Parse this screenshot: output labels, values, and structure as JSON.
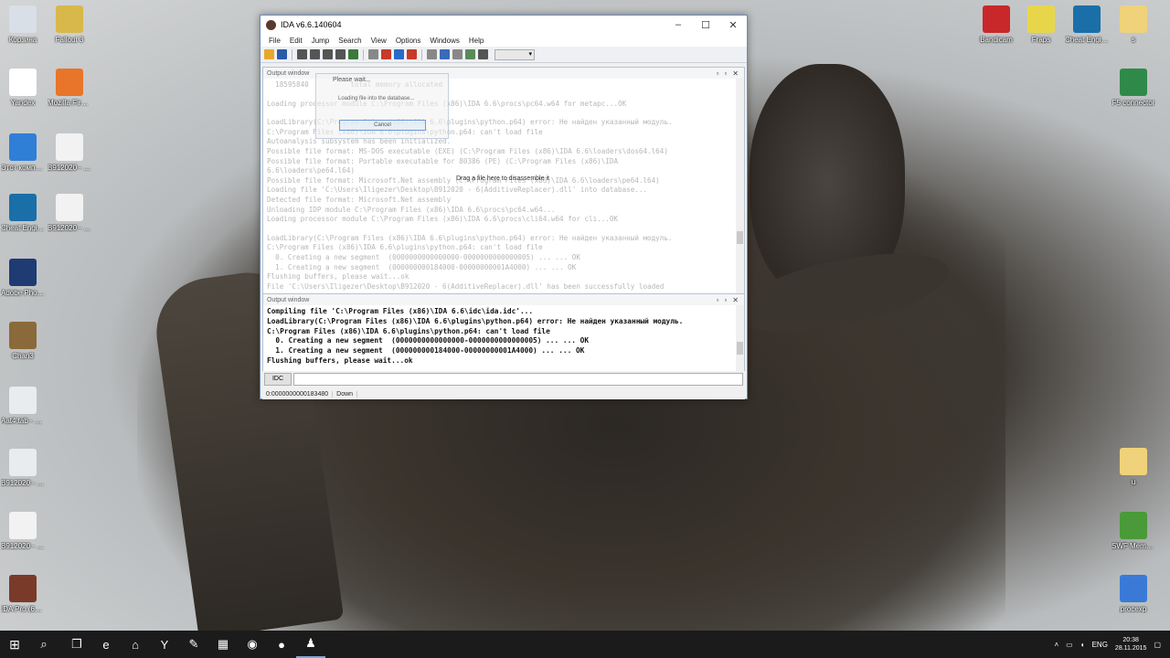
{
  "desktop_icons_left": [
    {
      "label": "Корзина",
      "icon": "recycle-bin-icon",
      "color": "#d9dfe6"
    },
    {
      "label": "Yandex",
      "icon": "yandex-icon",
      "color": "#ffffff"
    },
    {
      "label": "Этот компьютер",
      "icon": "computer-icon",
      "color": "#2f7fd6"
    },
    {
      "label": "Cheat Engine",
      "icon": "cheat-engine-icon",
      "color": "#1a6fa8"
    },
    {
      "label": "Adobe Photoshop",
      "icon": "photoshop-icon",
      "color": "#1f3b74"
    },
    {
      "label": "Chan3",
      "icon": "image-file-icon",
      "color": "#8a6a3a"
    },
    {
      "label": "Aat4.tab - 6(AdditiveRe...",
      "icon": "dll-file-icon",
      "color": "#e9ecef"
    },
    {
      "label": "B912020 - 6(AdditiveRe...",
      "icon": "dll-file-icon",
      "color": "#e9ecef"
    },
    {
      "label": "B912020 - 6(AdditiveRe...",
      "icon": "file-icon",
      "color": "#f2f2f2"
    },
    {
      "label": "IDA Pro (64-bit)",
      "icon": "ida-pro-icon",
      "color": "#7a3a2a"
    }
  ],
  "desktop_icons_left2": [
    {
      "label": "Fallout 3",
      "icon": "fallout-icon",
      "color": "#d8b84a"
    },
    {
      "label": "Mozilla Firefox",
      "icon": "firefox-icon",
      "color": "#e8752a"
    },
    {
      "label": "B912020 - 6(AdditiveRe...",
      "icon": "file-icon",
      "color": "#f2f2f2"
    },
    {
      "label": "B912020 - 6(AdditiveRe...",
      "icon": "file-icon",
      "color": "#f2f2f2"
    }
  ],
  "desktop_icons_right": [
    {
      "label": "Bandicam",
      "icon": "bandicam-icon",
      "color": "#c8282a"
    },
    {
      "label": "Fraps",
      "icon": "fraps-icon",
      "color": "#e8d64a"
    },
    {
      "label": "Cheat Engine",
      "icon": "cheat-engine-icon",
      "color": "#1a6fa8"
    },
    {
      "label": "s",
      "icon": "folder-icon",
      "color": "#f0d27a"
    },
    {
      "label": "F5 connector",
      "icon": "app-icon",
      "color": "#2f8a4a"
    },
    {
      "label": "u",
      "icon": "folder-icon",
      "color": "#f0d27a"
    },
    {
      "label": "SWF Memory Dumper",
      "icon": "memory-icon",
      "color": "#4a9a3a"
    },
    {
      "label": "procexp",
      "icon": "procexp-icon",
      "color": "#3a7ad6"
    }
  ],
  "ida": {
    "title": "IDA v6.6.140604",
    "menu": [
      "File",
      "Edit",
      "Jump",
      "Search",
      "View",
      "Options",
      "Windows",
      "Help"
    ],
    "toolbar_colors": [
      "#e6a82a",
      "#2a5aa8",
      "#555555",
      "#555555",
      "#555555",
      "#555555",
      "#3a7a3a",
      "#888888",
      "#c83a2a",
      "#2a6ac8",
      "#c83a2a",
      "#888888",
      "#3a6ab8",
      "#888888",
      "#5a8a5a",
      "#555555"
    ],
    "top_pane_title": "Output window",
    "top_log": [
      "  18595840          total memory allocated",
      "",
      "Loading processor module C:\\Program Files (x86)\\IDA 6.6\\procs\\pc64.w64 for metapc...OK",
      "",
      "LoadLibrary(C:\\Program Files (x86)\\IDA 6.6\\plugins\\python.p64) error: Не найден указанный модуль.",
      "C:\\Program Files (x86)\\IDA 6.6\\plugins\\python.p64: can't load file",
      "Autoanalysis subsystem has been initialized.",
      "Possible file format: MS-DOS executable (EXE) (C:\\Program Files (x86)\\IDA 6.6\\loaders\\dos64.l64)",
      "Possible file format: Portable executable for 80386 (PE) (C:\\Program Files (x86)\\IDA",
      "6.6\\loaders\\pe64.l64)",
      "Possible file format: Microsoft.Net assembly (C:\\Program Files (x86)\\IDA 6.6\\loaders\\pe64.l64)",
      "Loading file 'C:\\Users\\Iligezer\\Desktop\\B912020 - 6(AdditiveReplacer).dll' into database...",
      "Detected file format: Microsoft.Net assembly",
      "Unloading IDP module C:\\Program Files (x86)\\IDA 6.6\\procs\\pc64.w64...",
      "Loading processor module C:\\Program Files (x86)\\IDA 6.6\\procs\\cli64.w64 for cli...OK",
      "",
      "LoadLibrary(C:\\Program Files (x86)\\IDA 6.6\\plugins\\python.p64) error: Не найден указанный модуль.",
      "C:\\Program Files (x86)\\IDA 6.6\\plugins\\python.p64: can't load file",
      "  0. Creating a new segment  (0000000000000000-0000000000000005) ... ... OK",
      "  1. Creating a new segment  (000000000184000-00000000001A4000) ... ... OK",
      "Flushing buffers, please wait...ok",
      "File 'C:\\Users\\Iligezer\\Desktop\\B912020 - 6(AdditiveReplacer).dll' has been successfully loaded"
    ],
    "drag_hint": "Drag a file here to disassemble it",
    "dialog": {
      "title": "Please wait...",
      "text": "Loading file into the database...",
      "button": "Cancel"
    },
    "bottom_pane_title": "Output window",
    "bottom_log": [
      "Compiling file 'C:\\Program Files (x86)\\IDA 6.6\\idc\\ida.idc'...",
      "LoadLibrary(C:\\Program Files (x86)\\IDA 6.6\\plugins\\python.p64) error: Не найден указанный модуль.",
      "C:\\Program Files (x86)\\IDA 6.6\\plugins\\python.p64: can't load file",
      "  0. Creating a new segment  (0000000000000000-0000000000000005) ... ... OK",
      "  1. Creating a new segment  (000000000184000-00000000001A4000) ... ... OK",
      "Flushing buffers, please wait...ok"
    ],
    "idc_button": "IDC",
    "status_address": "0:0000000000183480",
    "status_state": "Down"
  },
  "taskbar": {
    "lang": "ENG",
    "time": "20:38",
    "date": "28.11.2015",
    "apps": [
      {
        "icon": "task-view-icon",
        "glyph": "❐"
      },
      {
        "icon": "edge-icon",
        "glyph": "e"
      },
      {
        "icon": "store-icon",
        "glyph": "⌂"
      },
      {
        "icon": "yandex-icon",
        "glyph": "Y"
      },
      {
        "icon": "paint-icon",
        "glyph": "✎"
      },
      {
        "icon": "calculator-icon",
        "glyph": "▦"
      },
      {
        "icon": "firefox-icon",
        "glyph": "◉"
      },
      {
        "icon": "bandicam-icon",
        "glyph": "●"
      },
      {
        "icon": "ida-pro-icon",
        "glyph": "♟"
      }
    ]
  }
}
